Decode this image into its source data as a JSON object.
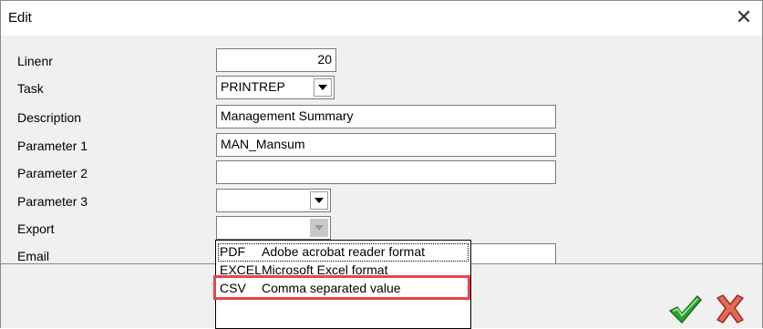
{
  "window": {
    "title": "Edit"
  },
  "form": {
    "linenr": {
      "label": "Linenr",
      "value": "20"
    },
    "task": {
      "label": "Task",
      "value": "PRINTREP"
    },
    "description": {
      "label": "Description",
      "value": "Management Summary"
    },
    "parameter1": {
      "label": "Parameter 1",
      "value": "MAN_Mansum"
    },
    "parameter2": {
      "label": "Parameter 2",
      "value": ""
    },
    "parameter3": {
      "label": "Parameter 3",
      "value": ""
    },
    "export": {
      "label": "Export",
      "value": ""
    },
    "email": {
      "label": "Email",
      "value": ""
    }
  },
  "export_options": [
    {
      "code": "PDF",
      "description": "Adobe acrobat reader format"
    },
    {
      "code": "EXCEL",
      "description": "Microsoft Excel format"
    },
    {
      "code": "CSV",
      "description": "Comma separated value"
    }
  ],
  "icons": {
    "close": "close-icon",
    "ok": "checkmark-icon",
    "cancel": "x-icon"
  },
  "colors": {
    "highlight": "#e5474b",
    "ok_green": "#2e9e2e",
    "cancel_red": "#c23b22"
  }
}
